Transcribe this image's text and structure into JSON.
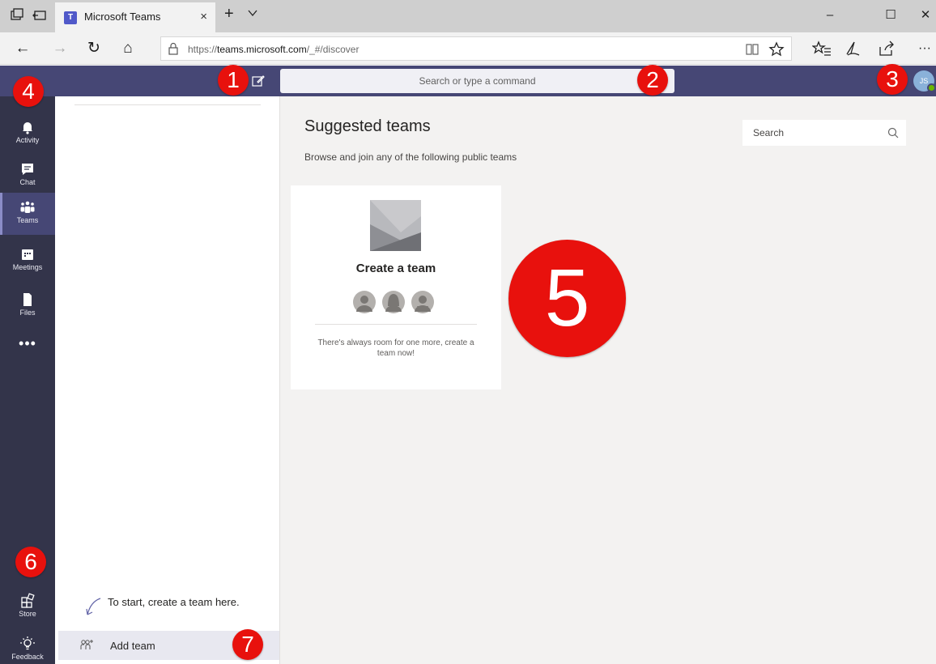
{
  "browser": {
    "tab_title": "Microsoft Teams",
    "tab_close": "×",
    "new_tab": "+",
    "tab_list": "⌵",
    "url_prefix": "https://",
    "url_host": "teams.microsoft.com",
    "url_path": "/_#/discover",
    "window_controls": {
      "minimize": "–",
      "maximize": "☐",
      "close": "✕"
    },
    "nav": {
      "back": "←",
      "forward": "→",
      "refresh": "↻",
      "home": "⌂",
      "more": "···"
    }
  },
  "header": {
    "command_placeholder": "Search or type a command",
    "avatar_initials": "JS",
    "presence_color": "#6bb700",
    "brand_color": "#464775"
  },
  "rail": {
    "items": [
      {
        "label": "Activity",
        "icon": "bell-icon"
      },
      {
        "label": "Chat",
        "icon": "chat-icon"
      },
      {
        "label": "Teams",
        "icon": "teams-icon",
        "active": true
      },
      {
        "label": "Meetings",
        "icon": "calendar-icon"
      },
      {
        "label": "Files",
        "icon": "file-icon"
      }
    ],
    "more": "•••",
    "bottom": [
      {
        "label": "Store",
        "icon": "store-icon"
      },
      {
        "label": "Feedback",
        "icon": "lightbulb-icon"
      }
    ]
  },
  "teams_panel": {
    "hint": "To start, create a team here.",
    "add_team": "Add team"
  },
  "main": {
    "title": "Suggested teams",
    "subtitle": "Browse and join any of the following public teams",
    "search_placeholder": "Search",
    "card": {
      "title": "Create a team",
      "description": "There's always room for one more, create a team now!"
    }
  },
  "markers": [
    "1",
    "2",
    "3",
    "4",
    "5",
    "6",
    "7"
  ]
}
